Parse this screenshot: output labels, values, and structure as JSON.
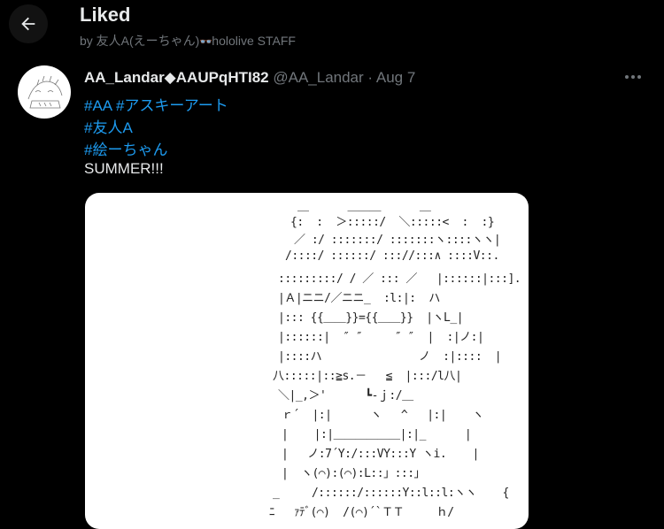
{
  "header": {
    "title": "Liked",
    "subtitle_prefix": "by 友人A(えーちゃん)",
    "subtitle_glasses": "👓",
    "subtitle_suffix": "hololive STAFF"
  },
  "tweet": {
    "display_name": "AA_Landar◆AAUPqHTI82",
    "handle": "@AA_Landar",
    "separator": "·",
    "date": "Aug 7",
    "more": "•••",
    "lines": [
      {
        "tags": [
          "#AA",
          "#アスキーアート"
        ]
      },
      {
        "tags": [
          "#友人A"
        ]
      },
      {
        "tags": [
          "#絵ーちゃん"
        ]
      },
      {
        "text": "SUMMER!!!"
      }
    ],
    "media": {
      "aa_lines": [
        "＿      ＿＿＿      ＿",
        "{:  :  ＞:::::/  ＼:::::<  :  :}",
        "／ :/ :::::::/ :::::::ヽ::::ヽヽ|",
        "/::::/ ::::::/ ::://:::∧ ::::V::.",
        ":::::::::/ / ／ ::: ／   |::::::|:::].",
        "|Ａ|ニニ/／ニニ_  :l:|:  ハ",
        "|::: {{＿＿}}={{＿＿}}  |ヽL_|",
        "|::::::|  ″ ″     ″ ″  |  :|ノ:|",
        "|::::ハ               ノ  :|::::  |",
        "八:::::|::≧s.－   ≦  |:::/l八|",
        "＼|_,＞'      ┗-ｊ:/＿",
        "ｒ´  |:|      ヽ   ^   |:|    ヽ",
        "|    |:|＿＿＿＿＿＿|:|_      |",
        "|   ノ:7´Y:/:::VY:::Y ヽi.    |",
        "|  ヽ(⌒):(⌒):L::」:::」",
        "_     /::::::/::::::Y::l::l:ヽヽ    {",
        "ﾆ   ｧﾃﾞ(⌒)  /(⌒)´`ＴＴ     ｈ/"
      ]
    }
  }
}
